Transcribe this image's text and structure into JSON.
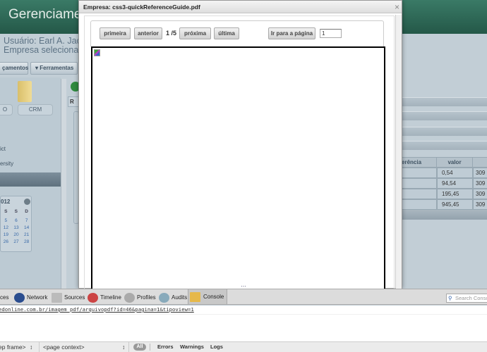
{
  "app": {
    "title": "Gerenciament",
    "user": "Usuário: Earl A. Jackso",
    "company": "Empresa selecionada:"
  },
  "menu": {
    "lancamentos": "çamentos",
    "ferramentas": "▾ Ferramentas"
  },
  "left": {
    "btn_o": "O",
    "btn_crm": "CRM",
    "item1": "ict",
    "item2": "ersity"
  },
  "calendar": {
    "year": "012",
    "days": [
      "S",
      "S",
      "D"
    ],
    "rows": [
      [
        "5",
        "6",
        "7"
      ],
      [
        "12",
        "13",
        "14"
      ],
      [
        "19",
        "20",
        "21"
      ],
      [
        "26",
        "27",
        "28"
      ]
    ]
  },
  "panel": {
    "tab": "R"
  },
  "table": {
    "headers": [
      "erência",
      "valor"
    ],
    "rows": [
      [
        "",
        "0,54",
        "309"
      ],
      [
        "",
        "94,54",
        "309"
      ],
      [
        "",
        "195,45",
        "309"
      ],
      [
        "",
        "945,45",
        "309"
      ]
    ]
  },
  "modal": {
    "title": "Empresa: css3-quickReferenceGuide.pdf",
    "close": "×",
    "first": "primeira",
    "prev": "anterior",
    "page_info": "1 /5",
    "next": "próxima",
    "last": "última",
    "goto": "Ir para a página",
    "page_value": "1",
    "resize": "⋯"
  },
  "devtools": {
    "tabs": [
      "ces",
      "Network",
      "Sources",
      "Timeline",
      "Profiles",
      "Audits",
      "Console"
    ],
    "search_placeholder": "Search Console",
    "url": "edonline.com.br/imagem_pdf/arquivopdf?id=46&pagina=1&tipoview=1",
    "frame": "ep frame>",
    "context": "<page context>",
    "filters": [
      "All",
      "Errors",
      "Warnings",
      "Logs"
    ]
  }
}
